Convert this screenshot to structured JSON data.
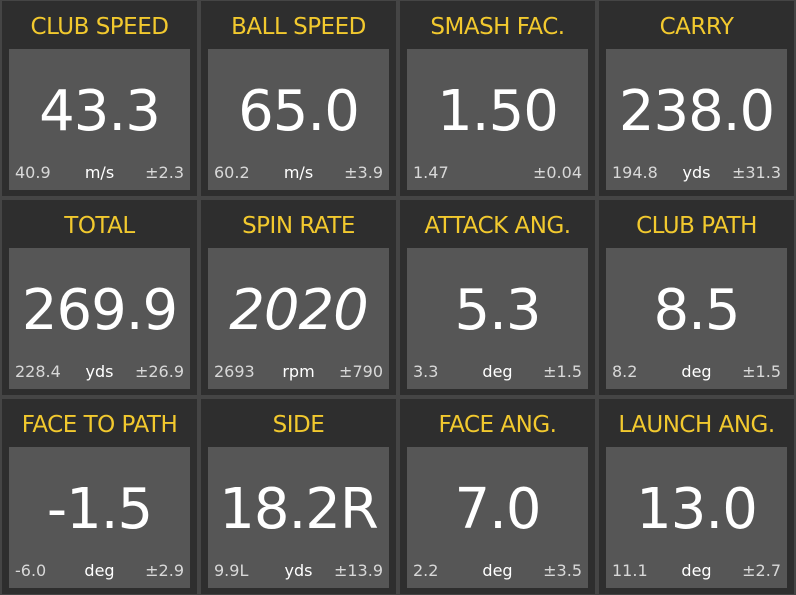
{
  "accent_color": "#f2c92e",
  "tiles": [
    {
      "title": "CLUB SPEED",
      "value": "43.3",
      "avg": "40.9",
      "unit": "m/s",
      "dev": "±2.3"
    },
    {
      "title": "BALL SPEED",
      "value": "65.0",
      "avg": "60.2",
      "unit": "m/s",
      "dev": "±3.9"
    },
    {
      "title": "SMASH FAC.",
      "value": "1.50",
      "avg": "1.47",
      "unit": "",
      "dev": "±0.04"
    },
    {
      "title": "CARRY",
      "value": "238.0",
      "avg": "194.8",
      "unit": "yds",
      "dev": "±31.3"
    },
    {
      "title": "TOTAL",
      "value": "269.9",
      "avg": "228.4",
      "unit": "yds",
      "dev": "±26.9"
    },
    {
      "title": "SPIN RATE",
      "value": "2020",
      "avg": "2693",
      "unit": "rpm",
      "dev": "±790",
      "italic": true
    },
    {
      "title": "ATTACK ANG.",
      "value": "5.3",
      "avg": "3.3",
      "unit": "deg",
      "dev": "±1.5"
    },
    {
      "title": "CLUB PATH",
      "value": "8.5",
      "avg": "8.2",
      "unit": "deg",
      "dev": "±1.5"
    },
    {
      "title": "FACE TO PATH",
      "value": "-1.5",
      "avg": "-6.0",
      "unit": "deg",
      "dev": "±2.9"
    },
    {
      "title": "SIDE",
      "value": "18.2R",
      "avg": "9.9L",
      "unit": "yds",
      "dev": "±13.9"
    },
    {
      "title": "FACE ANG.",
      "value": "7.0",
      "avg": "2.2",
      "unit": "deg",
      "dev": "±3.5"
    },
    {
      "title": "LAUNCH ANG.",
      "value": "13.0",
      "avg": "11.1",
      "unit": "deg",
      "dev": "±2.7"
    }
  ]
}
